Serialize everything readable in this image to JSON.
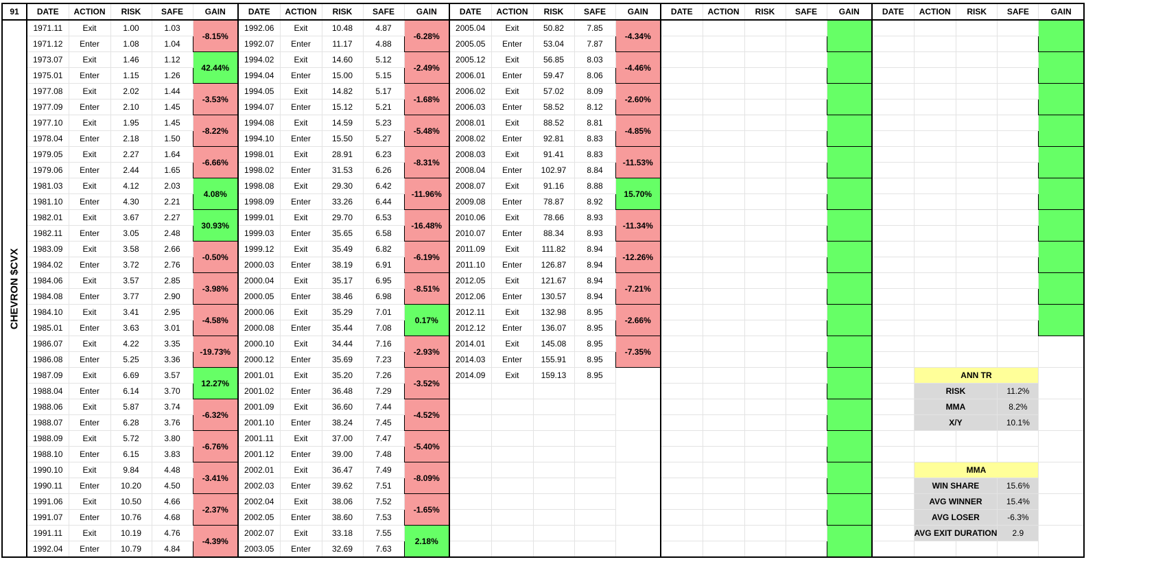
{
  "sheet": {
    "corner": "91",
    "side_label": "CHEVRON $CVX",
    "headers": [
      "DATE",
      "ACTION",
      "RISK",
      "SAFE",
      "GAIN"
    ]
  },
  "blocks": [
    {
      "rows": [
        [
          "1971.11",
          "Exit",
          "1.00",
          "1.03"
        ],
        [
          "1971.12",
          "Enter",
          "1.08",
          "1.04"
        ],
        [
          "1973.07",
          "Exit",
          "1.46",
          "1.12"
        ],
        [
          "1975.01",
          "Enter",
          "1.15",
          "1.26"
        ],
        [
          "1977.08",
          "Exit",
          "2.02",
          "1.44"
        ],
        [
          "1977.09",
          "Enter",
          "2.10",
          "1.45"
        ],
        [
          "1977.10",
          "Exit",
          "1.95",
          "1.45"
        ],
        [
          "1978.04",
          "Enter",
          "2.18",
          "1.50"
        ],
        [
          "1979.05",
          "Exit",
          "2.27",
          "1.64"
        ],
        [
          "1979.06",
          "Enter",
          "2.44",
          "1.65"
        ],
        [
          "1981.03",
          "Exit",
          "4.12",
          "2.03"
        ],
        [
          "1981.10",
          "Enter",
          "4.30",
          "2.21"
        ],
        [
          "1982.01",
          "Exit",
          "3.67",
          "2.27"
        ],
        [
          "1982.11",
          "Enter",
          "3.05",
          "2.48"
        ],
        [
          "1983.09",
          "Exit",
          "3.58",
          "2.66"
        ],
        [
          "1984.02",
          "Enter",
          "3.72",
          "2.76"
        ],
        [
          "1984.06",
          "Exit",
          "3.57",
          "2.85"
        ],
        [
          "1984.08",
          "Enter",
          "3.77",
          "2.90"
        ],
        [
          "1984.10",
          "Exit",
          "3.41",
          "2.95"
        ],
        [
          "1985.01",
          "Enter",
          "3.63",
          "3.01"
        ],
        [
          "1986.07",
          "Exit",
          "4.22",
          "3.35"
        ],
        [
          "1986.08",
          "Enter",
          "5.25",
          "3.36"
        ],
        [
          "1987.09",
          "Exit",
          "6.69",
          "3.57"
        ],
        [
          "1988.04",
          "Enter",
          "6.14",
          "3.70"
        ],
        [
          "1988.06",
          "Exit",
          "5.87",
          "3.74"
        ],
        [
          "1988.07",
          "Enter",
          "6.28",
          "3.76"
        ],
        [
          "1988.09",
          "Exit",
          "5.72",
          "3.80"
        ],
        [
          "1988.10",
          "Enter",
          "6.15",
          "3.83"
        ],
        [
          "1990.10",
          "Exit",
          "9.84",
          "4.48"
        ],
        [
          "1990.11",
          "Enter",
          "10.20",
          "4.50"
        ],
        [
          "1991.06",
          "Exit",
          "10.50",
          "4.66"
        ],
        [
          "1991.07",
          "Enter",
          "10.76",
          "4.68"
        ],
        [
          "1991.11",
          "Exit",
          "10.19",
          "4.76"
        ],
        [
          "1992.04",
          "Enter",
          "10.79",
          "4.84"
        ]
      ],
      "gains": [
        {
          "text": "-8.15%",
          "status": "loss"
        },
        {
          "text": "42.44%",
          "status": "win"
        },
        {
          "text": "-3.53%",
          "status": "loss"
        },
        {
          "text": "-8.22%",
          "status": "loss"
        },
        {
          "text": "-6.66%",
          "status": "loss"
        },
        {
          "text": "4.08%",
          "status": "win"
        },
        {
          "text": "30.93%",
          "status": "win"
        },
        {
          "text": "-0.50%",
          "status": "loss"
        },
        {
          "text": "-3.98%",
          "status": "loss"
        },
        {
          "text": "-4.58%",
          "status": "loss"
        },
        {
          "text": "-19.73%",
          "status": "loss"
        },
        {
          "text": "12.27%",
          "status": "win"
        },
        {
          "text": "-6.32%",
          "status": "loss"
        },
        {
          "text": "-6.76%",
          "status": "loss"
        },
        {
          "text": "-3.41%",
          "status": "loss"
        },
        {
          "text": "-2.37%",
          "status": "loss"
        },
        {
          "text": "-4.39%",
          "status": "loss"
        }
      ]
    },
    {
      "rows": [
        [
          "1992.06",
          "Exit",
          "10.48",
          "4.87"
        ],
        [
          "1992.07",
          "Enter",
          "11.17",
          "4.88"
        ],
        [
          "1994.02",
          "Exit",
          "14.60",
          "5.12"
        ],
        [
          "1994.04",
          "Enter",
          "15.00",
          "5.15"
        ],
        [
          "1994.05",
          "Exit",
          "14.82",
          "5.17"
        ],
        [
          "1994.07",
          "Enter",
          "15.12",
          "5.21"
        ],
        [
          "1994.08",
          "Exit",
          "14.59",
          "5.23"
        ],
        [
          "1994.10",
          "Enter",
          "15.50",
          "5.27"
        ],
        [
          "1998.01",
          "Exit",
          "28.91",
          "6.23"
        ],
        [
          "1998.02",
          "Enter",
          "31.53",
          "6.26"
        ],
        [
          "1998.08",
          "Exit",
          "29.30",
          "6.42"
        ],
        [
          "1998.09",
          "Enter",
          "33.26",
          "6.44"
        ],
        [
          "1999.01",
          "Exit",
          "29.70",
          "6.53"
        ],
        [
          "1999.03",
          "Enter",
          "35.65",
          "6.58"
        ],
        [
          "1999.12",
          "Exit",
          "35.49",
          "6.82"
        ],
        [
          "2000.03",
          "Enter",
          "38.19",
          "6.91"
        ],
        [
          "2000.04",
          "Exit",
          "35.17",
          "6.95"
        ],
        [
          "2000.05",
          "Enter",
          "38.46",
          "6.98"
        ],
        [
          "2000.06",
          "Exit",
          "35.29",
          "7.01"
        ],
        [
          "2000.08",
          "Enter",
          "35.44",
          "7.08"
        ],
        [
          "2000.10",
          "Exit",
          "34.44",
          "7.16"
        ],
        [
          "2000.12",
          "Enter",
          "35.69",
          "7.23"
        ],
        [
          "2001.01",
          "Exit",
          "35.20",
          "7.26"
        ],
        [
          "2001.02",
          "Enter",
          "36.48",
          "7.29"
        ],
        [
          "2001.09",
          "Exit",
          "36.60",
          "7.44"
        ],
        [
          "2001.10",
          "Enter",
          "38.24",
          "7.45"
        ],
        [
          "2001.11",
          "Exit",
          "37.00",
          "7.47"
        ],
        [
          "2001.12",
          "Enter",
          "39.00",
          "7.48"
        ],
        [
          "2002.01",
          "Exit",
          "36.47",
          "7.49"
        ],
        [
          "2002.03",
          "Enter",
          "39.62",
          "7.51"
        ],
        [
          "2002.04",
          "Exit",
          "38.06",
          "7.52"
        ],
        [
          "2002.05",
          "Enter",
          "38.60",
          "7.53"
        ],
        [
          "2002.07",
          "Exit",
          "33.18",
          "7.55"
        ],
        [
          "2003.05",
          "Enter",
          "32.69",
          "7.63"
        ]
      ],
      "gains": [
        {
          "text": "-6.28%",
          "status": "loss"
        },
        {
          "text": "-2.49%",
          "status": "loss"
        },
        {
          "text": "-1.68%",
          "status": "loss"
        },
        {
          "text": "-5.48%",
          "status": "loss"
        },
        {
          "text": "-8.31%",
          "status": "loss"
        },
        {
          "text": "-11.96%",
          "status": "loss"
        },
        {
          "text": "-16.48%",
          "status": "loss"
        },
        {
          "text": "-6.19%",
          "status": "loss"
        },
        {
          "text": "-8.51%",
          "status": "loss"
        },
        {
          "text": "0.17%",
          "status": "win"
        },
        {
          "text": "-2.93%",
          "status": "loss"
        },
        {
          "text": "-3.52%",
          "status": "loss"
        },
        {
          "text": "-4.52%",
          "status": "loss"
        },
        {
          "text": "-5.40%",
          "status": "loss"
        },
        {
          "text": "-8.09%",
          "status": "loss"
        },
        {
          "text": "-1.65%",
          "status": "loss"
        },
        {
          "text": "2.18%",
          "status": "win"
        }
      ]
    },
    {
      "rows": [
        [
          "2005.04",
          "Exit",
          "50.82",
          "7.85"
        ],
        [
          "2005.05",
          "Enter",
          "53.04",
          "7.87"
        ],
        [
          "2005.12",
          "Exit",
          "56.85",
          "8.03"
        ],
        [
          "2006.01",
          "Enter",
          "59.47",
          "8.06"
        ],
        [
          "2006.02",
          "Exit",
          "57.02",
          "8.09"
        ],
        [
          "2006.03",
          "Enter",
          "58.52",
          "8.12"
        ],
        [
          "2008.01",
          "Exit",
          "88.52",
          "8.81"
        ],
        [
          "2008.02",
          "Enter",
          "92.81",
          "8.83"
        ],
        [
          "2008.03",
          "Exit",
          "91.41",
          "8.83"
        ],
        [
          "2008.04",
          "Enter",
          "102.97",
          "8.84"
        ],
        [
          "2008.07",
          "Exit",
          "91.16",
          "8.88"
        ],
        [
          "2009.08",
          "Enter",
          "78.87",
          "8.92"
        ],
        [
          "2010.06",
          "Exit",
          "78.66",
          "8.93"
        ],
        [
          "2010.07",
          "Enter",
          "88.34",
          "8.93"
        ],
        [
          "2011.09",
          "Exit",
          "111.82",
          "8.94"
        ],
        [
          "2011.10",
          "Enter",
          "126.87",
          "8.94"
        ],
        [
          "2012.05",
          "Exit",
          "121.67",
          "8.94"
        ],
        [
          "2012.06",
          "Enter",
          "130.57",
          "8.94"
        ],
        [
          "2012.11",
          "Exit",
          "132.98",
          "8.95"
        ],
        [
          "2012.12",
          "Enter",
          "136.07",
          "8.95"
        ],
        [
          "2014.01",
          "Exit",
          "145.08",
          "8.95"
        ],
        [
          "2014.03",
          "Enter",
          "155.91",
          "8.95"
        ],
        [
          "2014.09",
          "Exit",
          "159.13",
          "8.95"
        ]
      ],
      "gains": [
        {
          "text": "-4.34%",
          "status": "loss"
        },
        {
          "text": "-4.46%",
          "status": "loss"
        },
        {
          "text": "-2.60%",
          "status": "loss"
        },
        {
          "text": "-4.85%",
          "status": "loss"
        },
        {
          "text": "-11.53%",
          "status": "loss"
        },
        {
          "text": "15.70%",
          "status": "win"
        },
        {
          "text": "-11.34%",
          "status": "loss"
        },
        {
          "text": "-12.26%",
          "status": "loss"
        },
        {
          "text": "-7.21%",
          "status": "loss"
        },
        {
          "text": "-2.66%",
          "status": "loss"
        },
        {
          "text": "-7.35%",
          "status": "loss"
        },
        {
          "text": "",
          "status": "none"
        },
        {
          "text": "",
          "status": "none"
        },
        {
          "text": "",
          "status": "none"
        },
        {
          "text": "",
          "status": "none"
        },
        {
          "text": "",
          "status": "none"
        },
        {
          "text": "",
          "status": "none"
        }
      ]
    },
    {
      "rows": [],
      "gains": [
        {
          "text": "",
          "status": "win"
        },
        {
          "text": "",
          "status": "win"
        },
        {
          "text": "",
          "status": "win"
        },
        {
          "text": "",
          "status": "win"
        },
        {
          "text": "",
          "status": "win"
        },
        {
          "text": "",
          "status": "win"
        },
        {
          "text": "",
          "status": "win"
        },
        {
          "text": "",
          "status": "win"
        },
        {
          "text": "",
          "status": "win"
        },
        {
          "text": "",
          "status": "win"
        },
        {
          "text": "",
          "status": "win"
        },
        {
          "text": "",
          "status": "win"
        },
        {
          "text": "",
          "status": "win"
        },
        {
          "text": "",
          "status": "win"
        },
        {
          "text": "",
          "status": "win"
        },
        {
          "text": "",
          "status": "win"
        },
        {
          "text": "",
          "status": "win"
        }
      ]
    },
    {
      "rows": [],
      "gains": [
        {
          "text": "",
          "status": "win"
        },
        {
          "text": "",
          "status": "win"
        },
        {
          "text": "",
          "status": "win"
        },
        {
          "text": "",
          "status": "win"
        },
        {
          "text": "",
          "status": "win"
        },
        {
          "text": "",
          "status": "win"
        },
        {
          "text": "",
          "status": "win"
        },
        {
          "text": "",
          "status": "win"
        },
        {
          "text": "",
          "status": "win"
        },
        {
          "text": "",
          "status": "win"
        },
        {
          "text": "",
          "status": "none"
        },
        {
          "text": "",
          "status": "none"
        },
        {
          "text": "",
          "status": "none"
        },
        {
          "text": "",
          "status": "none"
        },
        {
          "text": "",
          "status": "none"
        },
        {
          "text": "",
          "status": "none"
        },
        {
          "text": "",
          "status": "none"
        }
      ]
    }
  ],
  "stats": {
    "ann_tr": {
      "title": "ANN TR",
      "rows": [
        {
          "label": "RISK",
          "value": "11.2%"
        },
        {
          "label": "MMA",
          "value": "8.2%"
        },
        {
          "label": "X/Y",
          "value": "10.1%"
        }
      ]
    },
    "mma": {
      "title": "MMA",
      "rows": [
        {
          "label": "WIN SHARE",
          "value": "15.6%"
        },
        {
          "label": "AVG WINNER",
          "value": "15.4%"
        },
        {
          "label": "AVG LOSER",
          "value": "-6.3%"
        },
        {
          "label": "AVG EXIT DURATION",
          "value": "2.9"
        }
      ]
    }
  },
  "colors": {
    "loss": "#f79b9b",
    "win": "#66ff66",
    "stat_title": "#ffff99",
    "stat_body": "#d9d9d9",
    "gridline": "#e3e3e3"
  }
}
